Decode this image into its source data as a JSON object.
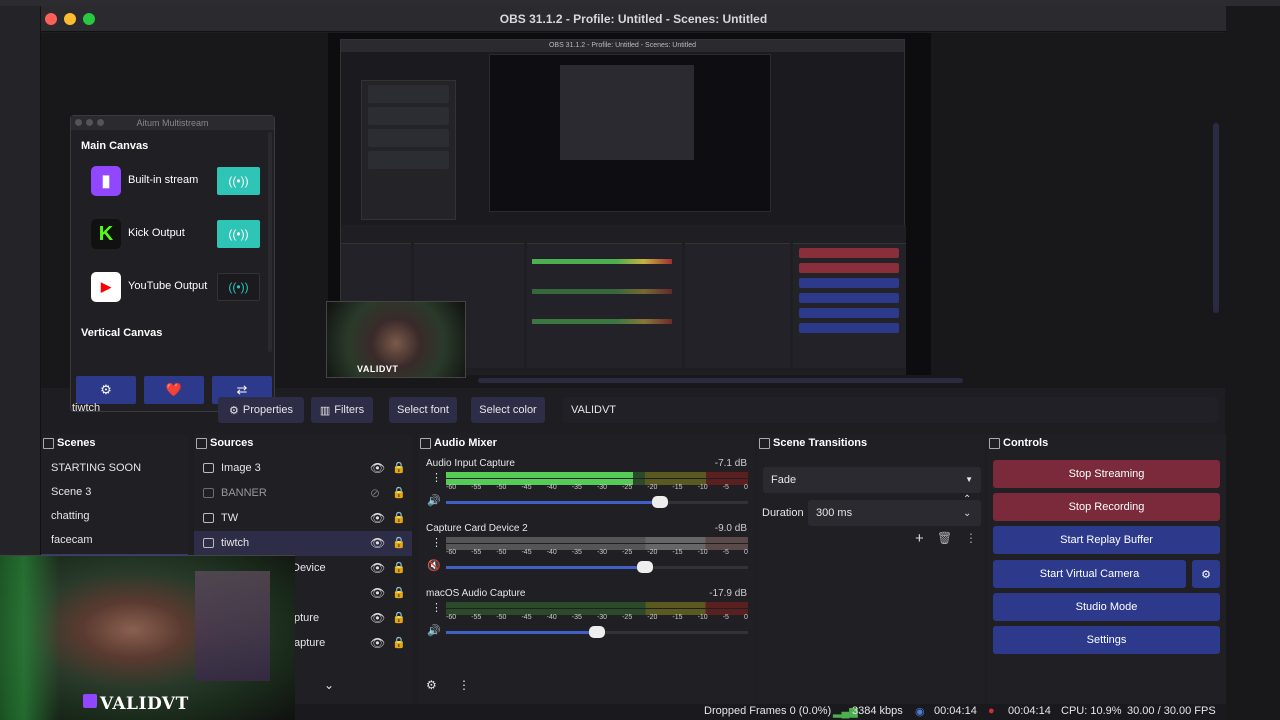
{
  "window": {
    "title": "OBS 31.1.2 - Profile: Untitled - Scenes: Untitled"
  },
  "nested_preview": {
    "title": "OBS 31.1.2 - Profile: Untitled - Scenes: Untitled"
  },
  "aitum": {
    "title": "Aitum Multistream",
    "main_canvas_label": "Main Canvas",
    "vertical_canvas_label": "Vertical Canvas",
    "outputs": [
      {
        "label": "Built-in stream",
        "logo": "twitch-icon",
        "active": true
      },
      {
        "label": "Kick Output",
        "logo": "kick-icon",
        "active": true
      },
      {
        "label": "YouTube Output",
        "logo": "youtube-icon",
        "active": false
      }
    ],
    "heart": "❤️"
  },
  "context": {
    "source_name": "tiwtch",
    "properties": "Properties",
    "filters": "Filters",
    "select_font": "Select font",
    "select_color": "Select color",
    "text_value": "VALIDVT"
  },
  "scenes": {
    "title": "Scenes",
    "items": [
      "STARTING SOON",
      "Scene 3",
      "chatting",
      "facecam"
    ]
  },
  "sources": {
    "title": "Sources",
    "items": [
      {
        "label": "Image 3"
      },
      {
        "label": "BANNER"
      },
      {
        "label": "TW"
      },
      {
        "label": "tiwtch"
      },
      {
        "label": "Device"
      },
      {
        "label": ""
      },
      {
        "label": "pture"
      },
      {
        "label": "apture"
      }
    ]
  },
  "mixer": {
    "title": "Audio Mixer",
    "scale": [
      "-60",
      "-55",
      "-50",
      "-45",
      "-40",
      "-35",
      "-30",
      "-25",
      "-20",
      "-15",
      "-10",
      "-5",
      "0"
    ],
    "channels": [
      {
        "name": "Audio Input Capture",
        "db": "-7.1 dB",
        "level": 0.62,
        "volume": 0.71,
        "muted": false
      },
      {
        "name": "Capture Card Device 2",
        "db": "-9.0 dB",
        "level": 0.0,
        "volume": 0.66,
        "muted": true
      },
      {
        "name": "macOS Audio Capture",
        "db": "-17.9 dB",
        "level": 0.0,
        "volume": 0.5,
        "muted": false
      }
    ]
  },
  "transitions": {
    "title": "Scene Transitions",
    "selected": "Fade",
    "duration_label": "Duration",
    "duration_value": "300 ms"
  },
  "controls": {
    "title": "Controls",
    "stop_streaming": "Stop Streaming",
    "stop_recording": "Stop Recording",
    "start_replay": "Start Replay Buffer",
    "start_virtual_cam": "Start Virtual Camera",
    "studio_mode": "Studio Mode",
    "settings": "Settings"
  },
  "status": {
    "dropped": "Dropped Frames 0 (0.0%)",
    "bitrate": "3384 kbps",
    "stream_time": "00:04:14",
    "rec_time": "00:04:14",
    "cpu": "CPU: 10.9%",
    "fps": "30.00 / 30.00 FPS"
  },
  "webcam": {
    "watermark": "VALIDVT"
  },
  "colors": {
    "accent_blue": "#2d3a8c",
    "stop_red": "#7a2a3a",
    "teal_toggle": "#2ec4b6",
    "twitch_purple": "#9146ff"
  }
}
